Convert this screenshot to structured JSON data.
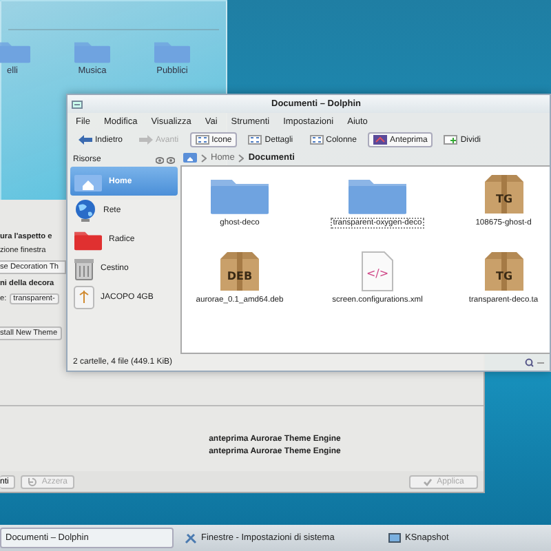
{
  "folder_window": {
    "folders": [
      {
        "label": "elli"
      },
      {
        "label": "Musica"
      },
      {
        "label": "Pubblici"
      }
    ]
  },
  "settings_window": {
    "lines": [
      {
        "kind": "heading",
        "text": "ura l'aspetto e"
      },
      {
        "kind": "text",
        "text": "zione finestra"
      },
      {
        "kind": "field",
        "text": "se Decoration Th"
      },
      {
        "kind": "heading",
        "text": "ni della decora"
      },
      {
        "kind": "combo",
        "label": "e:",
        "text": "transparent-"
      },
      {
        "kind": "button",
        "text": "stall New Theme"
      }
    ],
    "preview_captions": [
      "anteprima Aurorae Theme Engine",
      "anteprima Aurorae Theme Engine"
    ],
    "buttons": [
      {
        "label": "nti",
        "disabled": false
      },
      {
        "label": "Azzera",
        "disabled": true
      },
      {
        "label": "Applica",
        "disabled": true
      }
    ]
  },
  "dolphin": {
    "title": "Documenti – Dolphin",
    "menu": [
      "File",
      "Modifica",
      "Visualizza",
      "Vai",
      "Strumenti",
      "Impostazioni",
      "Aiuto"
    ],
    "toolbar": [
      {
        "kind": "nav",
        "label": "Indietro",
        "disabled": false
      },
      {
        "kind": "nav",
        "label": "Avanti",
        "disabled": true
      },
      {
        "kind": "view",
        "label": "Icone",
        "selected": true
      },
      {
        "kind": "view",
        "label": "Dettagli",
        "selected": false
      },
      {
        "kind": "view",
        "label": "Colonne",
        "selected": false
      },
      {
        "kind": "toggle",
        "label": "Anteprima",
        "on": true
      },
      {
        "kind": "toggle",
        "label": "Dividi",
        "on": false
      }
    ],
    "places": {
      "title": "Risorse",
      "items": [
        {
          "label": "Home",
          "selected": true
        },
        {
          "label": "Rete",
          "selected": false
        },
        {
          "label": "Radice",
          "selected": false
        },
        {
          "label": "Cestino",
          "selected": false
        },
        {
          "label": "JACOPO 4GB",
          "selected": false
        }
      ]
    },
    "breadcrumb": [
      "Home",
      "Documenti"
    ],
    "files": [
      {
        "name": "ghost-deco",
        "kind": "folder",
        "focused": false
      },
      {
        "name": "transparent-oxygen-deco",
        "kind": "folder",
        "focused": true
      },
      {
        "name": "108675-ghost-d",
        "kind": "archive",
        "badge": "TG",
        "focused": false
      },
      {
        "name": "aurorae_0.1_amd64.deb",
        "kind": "archive",
        "badge": "DEB",
        "focused": false
      },
      {
        "name": "screen.configurations.xml",
        "kind": "document",
        "badge": "</>",
        "focused": false
      },
      {
        "name": "transparent-deco.ta",
        "kind": "archive",
        "badge": "TG",
        "focused": false
      }
    ],
    "status": "2 cartelle, 4 file (449.1 KiB)"
  },
  "taskbar": [
    {
      "label": "Documenti – Dolphin",
      "selected": true
    },
    {
      "label": "Finestre - Impostazioni di sistema",
      "selected": false
    },
    {
      "label": "KSnapshot",
      "selected": false
    }
  ]
}
